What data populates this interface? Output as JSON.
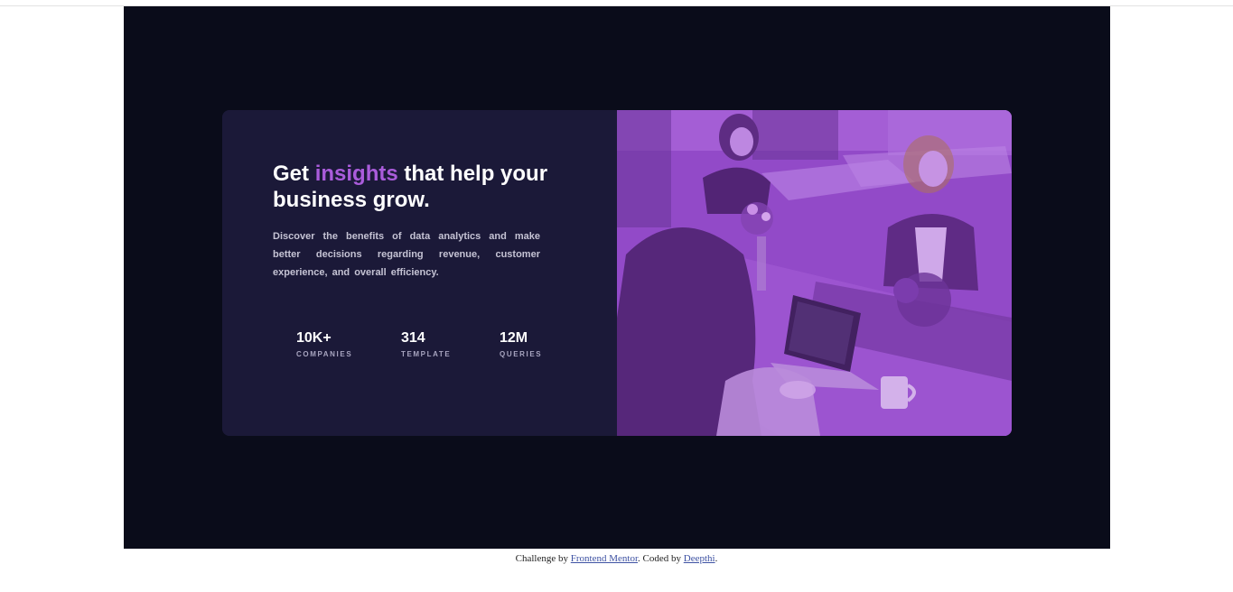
{
  "card": {
    "headline_before": "Get ",
    "headline_accent": "insights",
    "headline_after": " that help your business grow.",
    "description": "Discover the benefits of data analytics and make better decisions regarding revenue, customer experience, and overall efficiency.",
    "stats": [
      {
        "value": "10K+",
        "label": "COMPANIES"
      },
      {
        "value": "314",
        "label": "TEMPLATE"
      },
      {
        "value": "12M",
        "label": "QUERIES"
      }
    ]
  },
  "footer": {
    "prefix": "Challenge by ",
    "link1": "Frontend Mentor",
    "middle": ". Coded by ",
    "link2": "Deepthi",
    "suffix": "."
  },
  "colors": {
    "page_bg": "#0a0c1a",
    "card_bg": "#1b1938",
    "accent": "#aa5cdb",
    "image_overlay": "#8f49c4"
  },
  "icons": {
    "hero_image": "office-women-working-image"
  }
}
